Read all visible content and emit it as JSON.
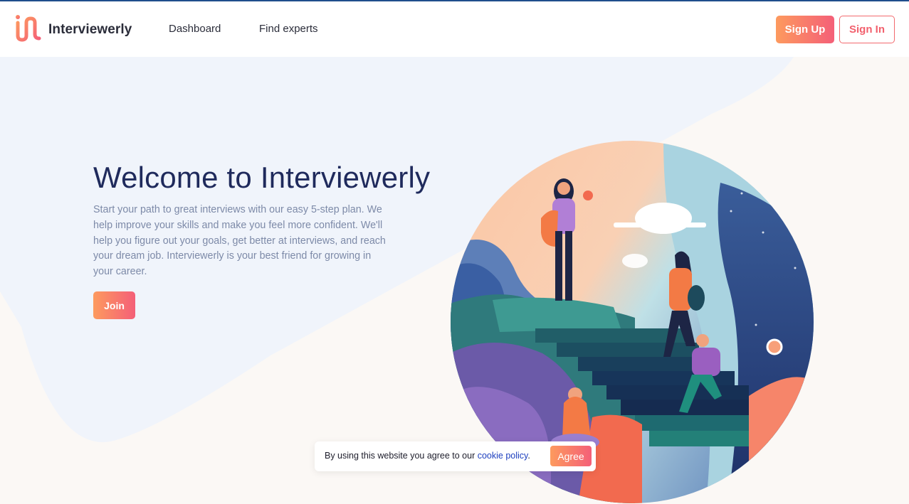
{
  "nav": {
    "brand": "Interviewerly",
    "links": [
      "Dashboard",
      "Find experts"
    ],
    "sign_up": "Sign Up",
    "sign_in": "Sign In"
  },
  "hero": {
    "title": "Welcome to Interviewerly",
    "description": "Start your path to great interviews with our easy 5-step plan. We help improve your skills and make you feel more confident. We'll help you figure out your goals, get better at interviews, and reach your dream job. Interviewerly is your best friend for growing in your career.",
    "join": "Join"
  },
  "cookie": {
    "text": "By using this website you agree to our ",
    "link": "cookie policy",
    "suffix": ".",
    "agree": "Agree"
  },
  "colors": {
    "accent_start": "#fd9a5e",
    "accent_end": "#f45f78",
    "title": "#1f2a5c",
    "muted": "#7d8aa8",
    "nav_top_line": "#1f4e8c"
  },
  "icons": {
    "logo": "interviewerly-logo-icon",
    "illustration": "hiking-people-illustration"
  }
}
